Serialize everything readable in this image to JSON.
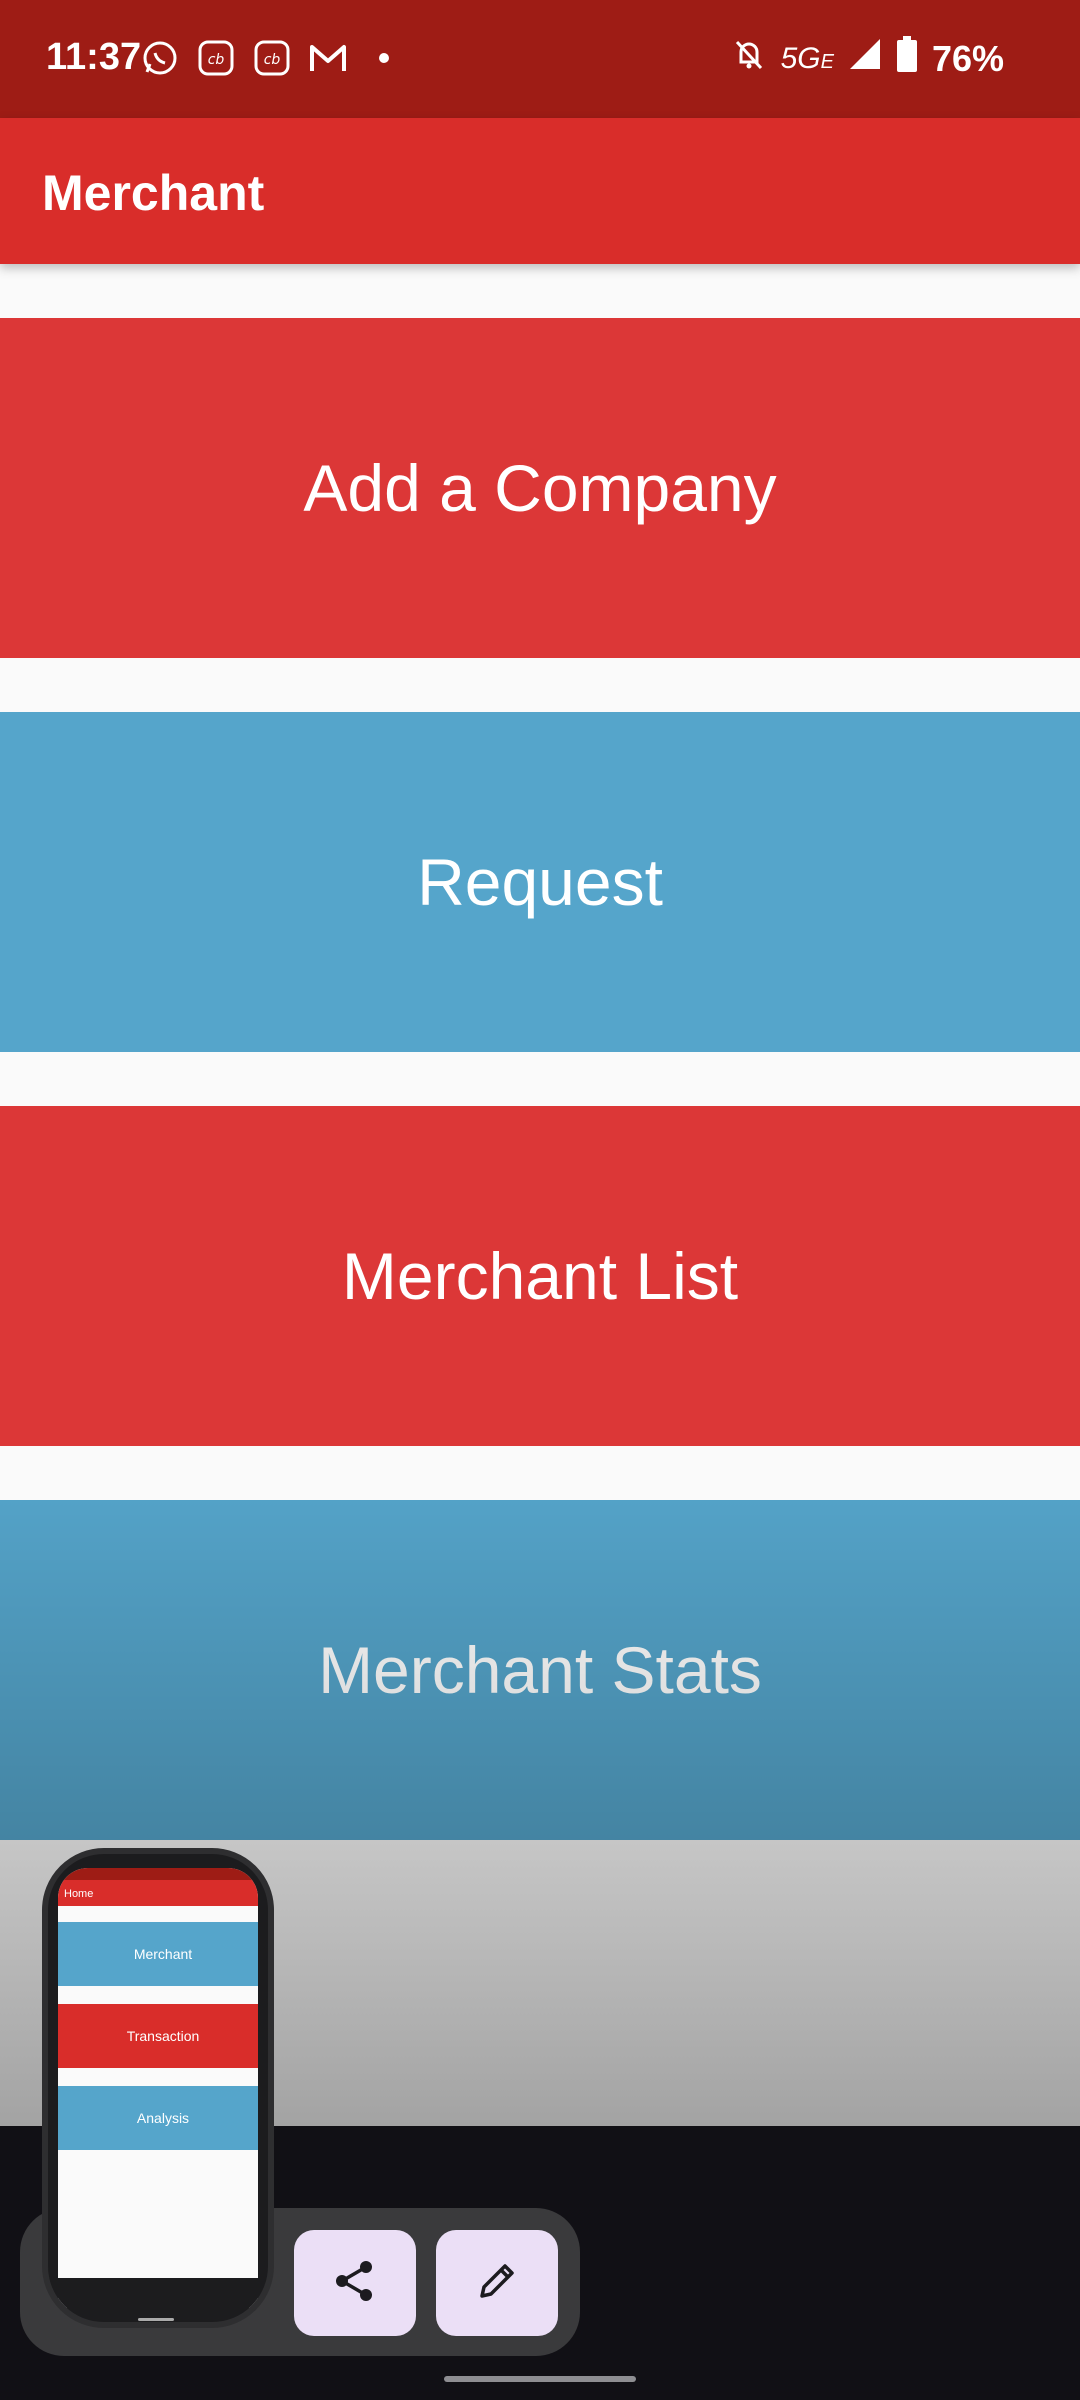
{
  "status_bar": {
    "time": "11:37",
    "network": "5G",
    "network_suffix": "E",
    "battery": "76%",
    "left_icons": [
      "whatsapp-icon",
      "cb-app-icon",
      "cb-app-icon",
      "gmail-icon",
      "notification-dot-icon"
    ],
    "right_icons": [
      "bell-off-icon",
      "signal-icon",
      "battery-icon"
    ]
  },
  "app_bar": {
    "title": "Merchant"
  },
  "menu": {
    "items": [
      {
        "label": "Add a Company",
        "color": "#dc3737"
      },
      {
        "label": "Request",
        "color": "#55a5cb"
      },
      {
        "label": "Merchant List",
        "color": "#dc3737"
      },
      {
        "label": "Merchant Stats",
        "color": "#55a5cb"
      }
    ]
  },
  "screenshot_preview": {
    "app_bar_title": "Home",
    "items": [
      "Merchant",
      "Transaction",
      "Analysis"
    ]
  },
  "actions": {
    "share_icon": "share-icon",
    "edit_icon": "pencil-icon"
  }
}
